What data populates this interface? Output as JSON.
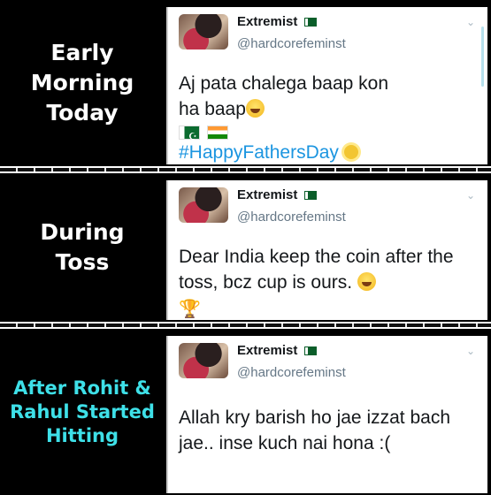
{
  "panels": [
    {
      "caption": [
        "Early",
        "Morning",
        "Today"
      ],
      "tweet": {
        "name": "Extremist",
        "handle": "@hardcorefeminst",
        "line1": "Aj pata chalega baap kon",
        "line2": "ha baap",
        "hashtag": "#HappyFathersDay"
      }
    },
    {
      "caption": [
        "During",
        "Toss"
      ],
      "tweet": {
        "name": "Extremist",
        "handle": "@hardcorefeminst",
        "line1": "Dear India keep the coin after the",
        "line2": "toss, bcz cup is ours."
      }
    },
    {
      "caption": [
        "After Rohit &",
        "Rahul Started",
        "Hitting"
      ],
      "caption_color": "#3ee0e8",
      "tweet": {
        "name": "Extremist",
        "handle": "@hardcorefeminst",
        "line1": "Allah kry barish ho jae izzat bach",
        "line2": "jae.. inse kuch nai hona :("
      }
    }
  ],
  "icons": [
    "pakistan-flag-icon",
    "india-flag-icon",
    "laughing-emoji-icon",
    "sun-emoji-icon",
    "trophy-icon",
    "chevron-down-icon"
  ]
}
